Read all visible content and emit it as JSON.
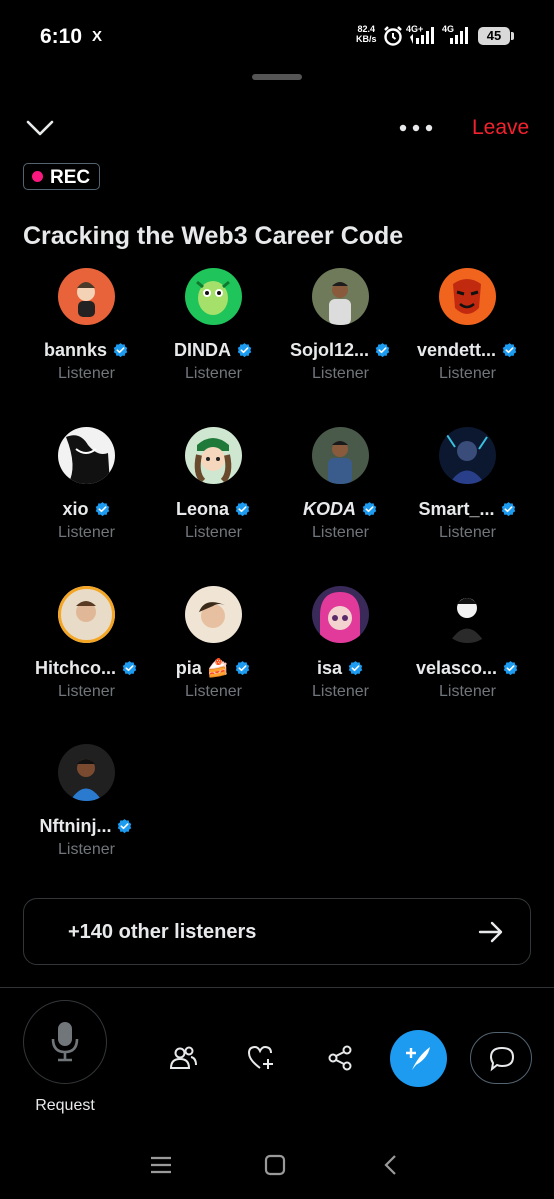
{
  "status_bar": {
    "time": "6:10",
    "app_indicator": "X",
    "net_speed_value": "82.4",
    "net_speed_unit": "KB/s",
    "network_1": "4G+",
    "network_2": "4G",
    "battery": "45"
  },
  "header": {
    "collapse_icon": "chevron-down-icon",
    "more_icon": "more-dots-icon",
    "leave_label": "Leave"
  },
  "recording": {
    "label": "REC"
  },
  "space": {
    "title": "Cracking the Web3 Career Code"
  },
  "listeners": [
    {
      "name": "bannks",
      "role": "Listener"
    },
    {
      "name": "DINDA",
      "role": "Listener"
    },
    {
      "name": "Sojol12...",
      "role": "Listener"
    },
    {
      "name": "vendett...",
      "role": "Listener"
    },
    {
      "name": "xio",
      "role": "Listener"
    },
    {
      "name": "Leona",
      "role": "Listener"
    },
    {
      "name": "KODA",
      "role": "Listener"
    },
    {
      "name": "Smart_...",
      "role": "Listener"
    },
    {
      "name": "Hitchco...",
      "role": "Listener"
    },
    {
      "name": "pia 🍰",
      "role": "Listener"
    },
    {
      "name": "isa",
      "role": "Listener"
    },
    {
      "name": "velasco...",
      "role": "Listener"
    },
    {
      "name": "Nftninj...",
      "role": "Listener"
    }
  ],
  "others": {
    "label": "+140 other listeners",
    "icon": "arrow-right-icon"
  },
  "toolbar": {
    "request_label": "Request",
    "icons": [
      "microphone-icon",
      "people-icon",
      "heart-plus-icon",
      "share-icon",
      "compose-icon",
      "chat-bubble-icon"
    ]
  },
  "nav": {
    "icons": [
      "menu-icon",
      "home-square-icon",
      "back-icon"
    ]
  },
  "colors": {
    "accent": "#1d9bf0",
    "leave": "#f4212e",
    "rec_dot": "#f91880",
    "muted": "#71767b"
  }
}
